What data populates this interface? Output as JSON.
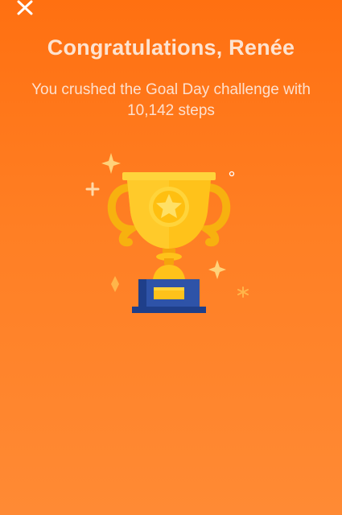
{
  "header": {
    "close_icon": "close-icon"
  },
  "celebration": {
    "title": "Congratulations, Renée",
    "message": "You crushed the Goal Day challenge with 10,142 steps"
  },
  "illustration": {
    "icon": "trophy-icon",
    "colors": {
      "background_top": "#ff7011",
      "background_bottom": "#ff8a34",
      "gold": "#ffc21a",
      "gold_dark": "#f5a40c",
      "base_blue": "#2e53a8",
      "base_blue_dark": "#1f3f8a",
      "sparkle": "#ffd27a"
    }
  }
}
